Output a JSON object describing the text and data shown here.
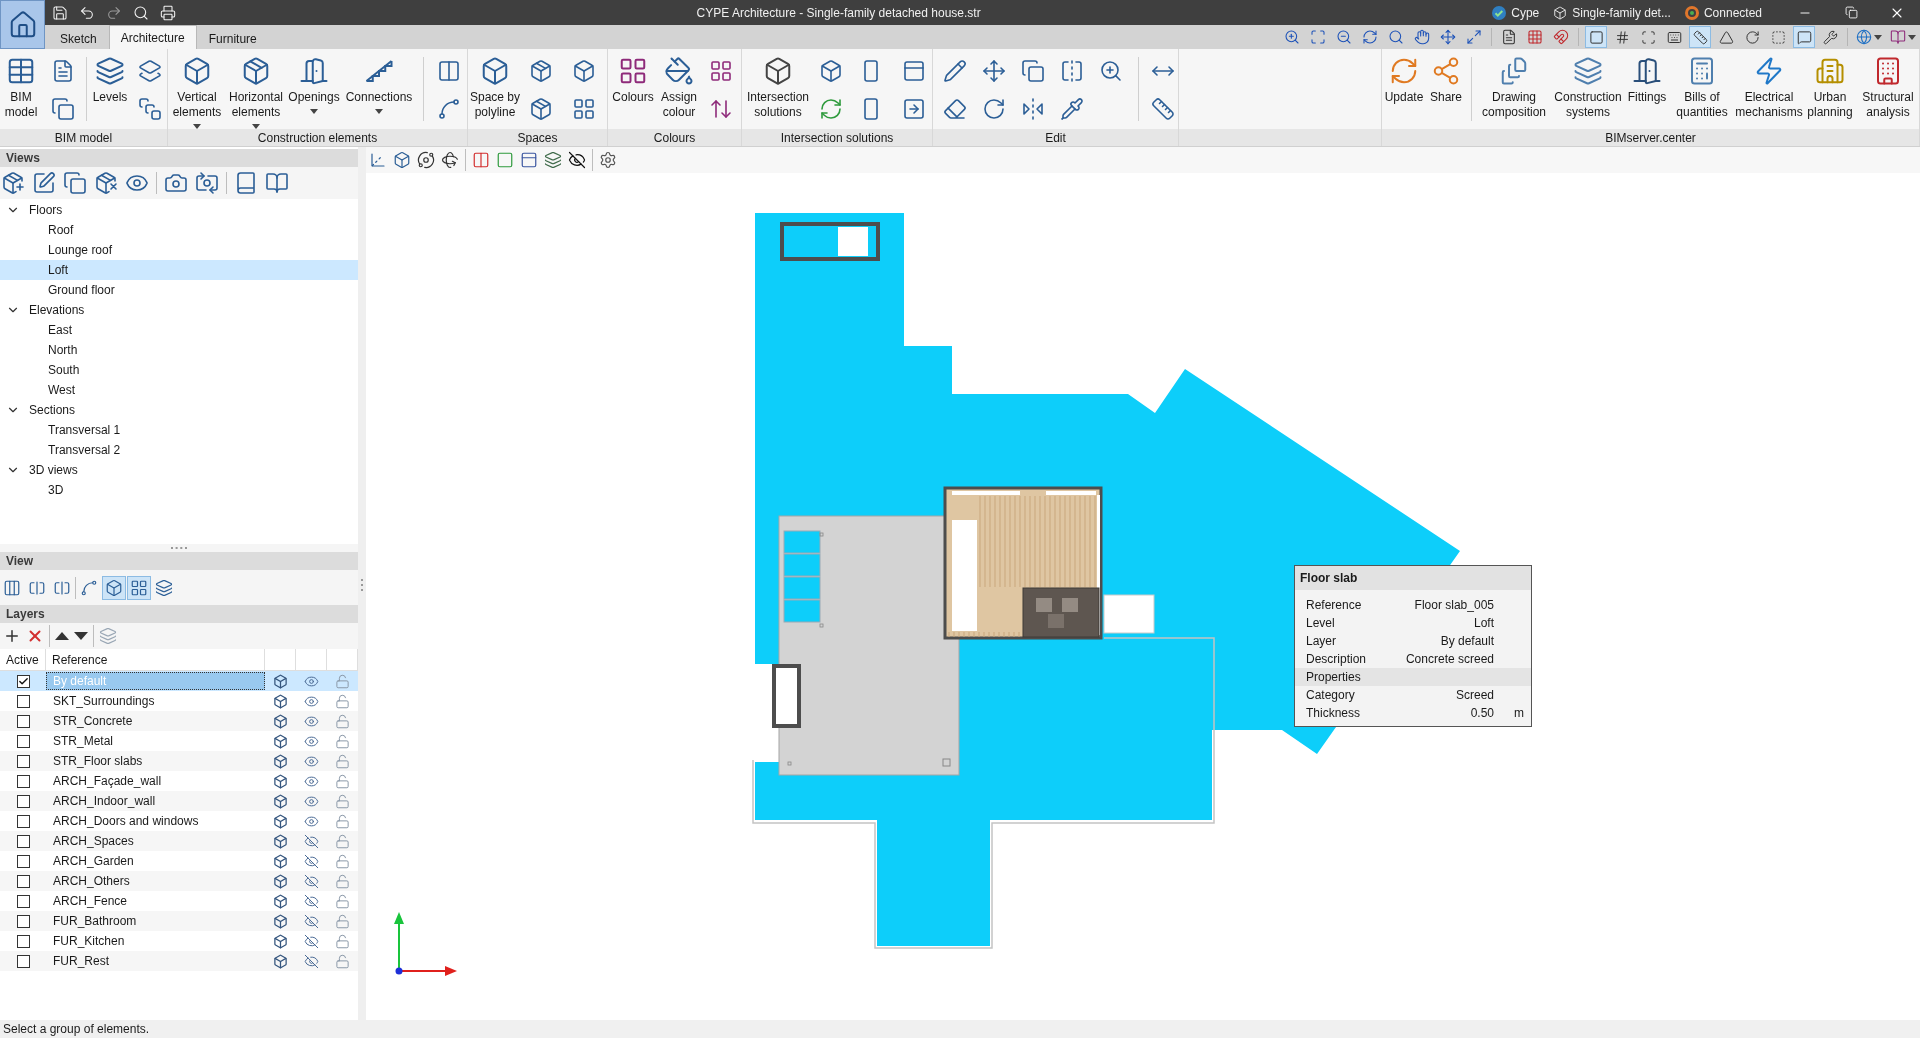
{
  "window": {
    "title": "CYPE Architecture - Single-family detached house.str",
    "account": "Cype",
    "project": "Single-family det...",
    "connection": "Connected"
  },
  "ribbon": {
    "tabs": [
      {
        "label": "Sketch",
        "selected": false
      },
      {
        "label": "Architecture",
        "selected": true
      },
      {
        "label": "Furniture",
        "selected": false
      }
    ],
    "toggles": [
      {
        "on": true
      },
      {
        "on": false
      },
      {
        "on": false
      },
      {
        "on": false
      },
      {
        "on": true
      },
      {
        "on": false
      },
      {
        "on": false
      },
      {
        "on": false
      },
      {
        "on": true
      },
      {
        "on": false
      }
    ],
    "groups": [
      {
        "label": "BIM model",
        "buttons": [
          {
            "label": "BIM\nmodel",
            "menu": false
          },
          {
            "label": "Levels",
            "menu": false
          }
        ]
      },
      {
        "label": "Construction elements",
        "buttons": [
          {
            "label": "Vertical\nelements",
            "menu": true
          },
          {
            "label": "Horizontal\nelements",
            "menu": true
          },
          {
            "label": "Openings",
            "menu": true
          },
          {
            "label": "Connections",
            "menu": true
          }
        ]
      },
      {
        "label": "Spaces",
        "buttons": [
          {
            "label": "Space by\npolyline",
            "menu": false
          }
        ]
      },
      {
        "label": "Colours",
        "buttons": [
          {
            "label": "Colours",
            "menu": false
          },
          {
            "label": "Assign\ncolour",
            "menu": false
          }
        ]
      },
      {
        "label": "Intersection solutions",
        "buttons": [
          {
            "label": "Intersection\nsolutions",
            "menu": false
          }
        ]
      },
      {
        "label": "Edit"
      },
      {
        "label": "BIMserver.center",
        "buttons": [
          {
            "label": "Update",
            "menu": false
          },
          {
            "label": "Share",
            "menu": false
          },
          {
            "label": "Drawing\ncomposition",
            "menu": false
          },
          {
            "label": "Construction\nsystems",
            "menu": false
          },
          {
            "label": "Fittings",
            "menu": false
          },
          {
            "label": "Bills of\nquantities",
            "menu": false
          },
          {
            "label": "Electrical\nmechanisms",
            "menu": false
          },
          {
            "label": "Urban\nplanning",
            "menu": false
          },
          {
            "label": "Structural\nanalysis",
            "menu": false
          }
        ]
      }
    ]
  },
  "views": {
    "title": "Views",
    "tree": [
      {
        "label": "Floors",
        "expanded": true,
        "selected": false,
        "children": [
          {
            "label": "Roof",
            "selected": false
          },
          {
            "label": "Lounge roof",
            "selected": false
          },
          {
            "label": "Loft",
            "selected": true
          },
          {
            "label": "Ground floor",
            "selected": false
          }
        ]
      },
      {
        "label": "Elevations",
        "expanded": true,
        "selected": false,
        "children": [
          {
            "label": "East",
            "selected": false
          },
          {
            "label": "North",
            "selected": false
          },
          {
            "label": "South",
            "selected": false
          },
          {
            "label": "West",
            "selected": false
          }
        ]
      },
      {
        "label": "Sections",
        "expanded": true,
        "selected": false,
        "children": [
          {
            "label": "Transversal 1",
            "selected": false
          },
          {
            "label": "Transversal 2",
            "selected": false
          }
        ]
      },
      {
        "label": "3D views",
        "expanded": true,
        "selected": false,
        "children": [
          {
            "label": "3D",
            "selected": false
          }
        ]
      }
    ]
  },
  "view_panel": {
    "title": "View",
    "tools": [
      {
        "on": false
      },
      {
        "on": false
      },
      {
        "on": false
      },
      {
        "on": false
      },
      {
        "on": true
      },
      {
        "on": true
      },
      {
        "on": false
      }
    ]
  },
  "layers": {
    "title": "Layers",
    "columns": [
      "Active",
      "Reference"
    ],
    "rows": [
      {
        "reference": "By default",
        "active": true,
        "selected": true,
        "visible": true,
        "locked": false
      },
      {
        "reference": "SKT_Surroundings",
        "active": false,
        "selected": false,
        "visible": true,
        "locked": false
      },
      {
        "reference": "STR_Concrete",
        "active": false,
        "selected": false,
        "visible": true,
        "locked": false
      },
      {
        "reference": "STR_Metal",
        "active": false,
        "selected": false,
        "visible": true,
        "locked": false
      },
      {
        "reference": "STR_Floor slabs",
        "active": false,
        "selected": false,
        "visible": true,
        "locked": false
      },
      {
        "reference": "ARCH_Façade_wall",
        "active": false,
        "selected": false,
        "visible": true,
        "locked": false
      },
      {
        "reference": "ARCH_Indoor_wall",
        "active": false,
        "selected": false,
        "visible": true,
        "locked": false
      },
      {
        "reference": "ARCH_Doors and windows",
        "active": false,
        "selected": false,
        "visible": true,
        "locked": false
      },
      {
        "reference": "ARCH_Spaces",
        "active": false,
        "selected": false,
        "visible": false,
        "locked": false
      },
      {
        "reference": "ARCH_Garden",
        "active": false,
        "selected": false,
        "visible": false,
        "locked": false
      },
      {
        "reference": "ARCH_Others",
        "active": false,
        "selected": false,
        "visible": false,
        "locked": false
      },
      {
        "reference": "ARCH_Fence",
        "active": false,
        "selected": false,
        "visible": false,
        "locked": false
      },
      {
        "reference": "FUR_Bathroom",
        "active": false,
        "selected": false,
        "visible": false,
        "locked": false
      },
      {
        "reference": "FUR_Kitchen",
        "active": false,
        "selected": false,
        "visible": false,
        "locked": false
      },
      {
        "reference": "FUR_Rest",
        "active": false,
        "selected": false,
        "visible": false,
        "locked": false
      }
    ]
  },
  "tooltip": {
    "title": "Floor slab",
    "rows": [
      {
        "label": "Reference",
        "value": "Floor slab_005"
      },
      {
        "label": "Level",
        "value": "Loft"
      },
      {
        "label": "Layer",
        "value": "By default"
      },
      {
        "label": "Description",
        "value": "Concrete screed"
      }
    ],
    "properties": {
      "title": "Properties",
      "rows": [
        {
          "label": "Category",
          "value": "Screed"
        },
        {
          "label": "Thickness",
          "value": "0.50",
          "unit": "m"
        }
      ]
    }
  },
  "status_bar": {
    "message": "Select a group of elements."
  }
}
